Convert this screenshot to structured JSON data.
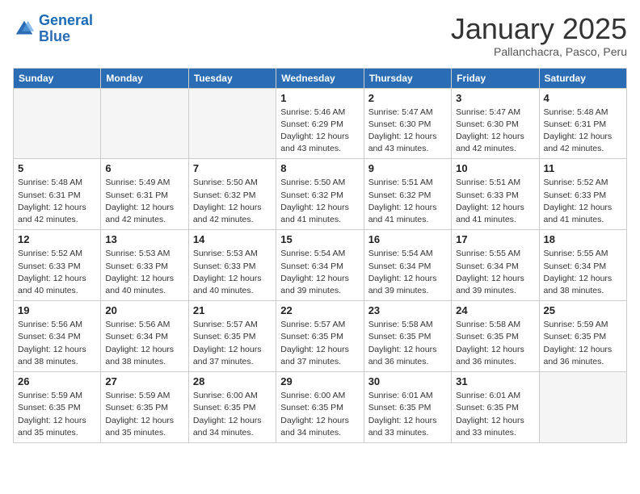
{
  "header": {
    "logo_general": "General",
    "logo_blue": "Blue",
    "month_title": "January 2025",
    "subtitle": "Pallanchacra, Pasco, Peru"
  },
  "weekdays": [
    "Sunday",
    "Monday",
    "Tuesday",
    "Wednesday",
    "Thursday",
    "Friday",
    "Saturday"
  ],
  "weeks": [
    [
      {
        "day": "",
        "sunrise": "",
        "sunset": "",
        "daylight": "",
        "empty": true
      },
      {
        "day": "",
        "sunrise": "",
        "sunset": "",
        "daylight": "",
        "empty": true
      },
      {
        "day": "",
        "sunrise": "",
        "sunset": "",
        "daylight": "",
        "empty": true
      },
      {
        "day": "1",
        "sunrise": "Sunrise: 5:46 AM",
        "sunset": "Sunset: 6:29 PM",
        "daylight": "Daylight: 12 hours and 43 minutes."
      },
      {
        "day": "2",
        "sunrise": "Sunrise: 5:47 AM",
        "sunset": "Sunset: 6:30 PM",
        "daylight": "Daylight: 12 hours and 43 minutes."
      },
      {
        "day": "3",
        "sunrise": "Sunrise: 5:47 AM",
        "sunset": "Sunset: 6:30 PM",
        "daylight": "Daylight: 12 hours and 42 minutes."
      },
      {
        "day": "4",
        "sunrise": "Sunrise: 5:48 AM",
        "sunset": "Sunset: 6:31 PM",
        "daylight": "Daylight: 12 hours and 42 minutes."
      }
    ],
    [
      {
        "day": "5",
        "sunrise": "Sunrise: 5:48 AM",
        "sunset": "Sunset: 6:31 PM",
        "daylight": "Daylight: 12 hours and 42 minutes."
      },
      {
        "day": "6",
        "sunrise": "Sunrise: 5:49 AM",
        "sunset": "Sunset: 6:31 PM",
        "daylight": "Daylight: 12 hours and 42 minutes."
      },
      {
        "day": "7",
        "sunrise": "Sunrise: 5:50 AM",
        "sunset": "Sunset: 6:32 PM",
        "daylight": "Daylight: 12 hours and 42 minutes."
      },
      {
        "day": "8",
        "sunrise": "Sunrise: 5:50 AM",
        "sunset": "Sunset: 6:32 PM",
        "daylight": "Daylight: 12 hours and 41 minutes."
      },
      {
        "day": "9",
        "sunrise": "Sunrise: 5:51 AM",
        "sunset": "Sunset: 6:32 PM",
        "daylight": "Daylight: 12 hours and 41 minutes."
      },
      {
        "day": "10",
        "sunrise": "Sunrise: 5:51 AM",
        "sunset": "Sunset: 6:33 PM",
        "daylight": "Daylight: 12 hours and 41 minutes."
      },
      {
        "day": "11",
        "sunrise": "Sunrise: 5:52 AM",
        "sunset": "Sunset: 6:33 PM",
        "daylight": "Daylight: 12 hours and 41 minutes."
      }
    ],
    [
      {
        "day": "12",
        "sunrise": "Sunrise: 5:52 AM",
        "sunset": "Sunset: 6:33 PM",
        "daylight": "Daylight: 12 hours and 40 minutes."
      },
      {
        "day": "13",
        "sunrise": "Sunrise: 5:53 AM",
        "sunset": "Sunset: 6:33 PM",
        "daylight": "Daylight: 12 hours and 40 minutes."
      },
      {
        "day": "14",
        "sunrise": "Sunrise: 5:53 AM",
        "sunset": "Sunset: 6:33 PM",
        "daylight": "Daylight: 12 hours and 40 minutes."
      },
      {
        "day": "15",
        "sunrise": "Sunrise: 5:54 AM",
        "sunset": "Sunset: 6:34 PM",
        "daylight": "Daylight: 12 hours and 39 minutes."
      },
      {
        "day": "16",
        "sunrise": "Sunrise: 5:54 AM",
        "sunset": "Sunset: 6:34 PM",
        "daylight": "Daylight: 12 hours and 39 minutes."
      },
      {
        "day": "17",
        "sunrise": "Sunrise: 5:55 AM",
        "sunset": "Sunset: 6:34 PM",
        "daylight": "Daylight: 12 hours and 39 minutes."
      },
      {
        "day": "18",
        "sunrise": "Sunrise: 5:55 AM",
        "sunset": "Sunset: 6:34 PM",
        "daylight": "Daylight: 12 hours and 38 minutes."
      }
    ],
    [
      {
        "day": "19",
        "sunrise": "Sunrise: 5:56 AM",
        "sunset": "Sunset: 6:34 PM",
        "daylight": "Daylight: 12 hours and 38 minutes."
      },
      {
        "day": "20",
        "sunrise": "Sunrise: 5:56 AM",
        "sunset": "Sunset: 6:34 PM",
        "daylight": "Daylight: 12 hours and 38 minutes."
      },
      {
        "day": "21",
        "sunrise": "Sunrise: 5:57 AM",
        "sunset": "Sunset: 6:35 PM",
        "daylight": "Daylight: 12 hours and 37 minutes."
      },
      {
        "day": "22",
        "sunrise": "Sunrise: 5:57 AM",
        "sunset": "Sunset: 6:35 PM",
        "daylight": "Daylight: 12 hours and 37 minutes."
      },
      {
        "day": "23",
        "sunrise": "Sunrise: 5:58 AM",
        "sunset": "Sunset: 6:35 PM",
        "daylight": "Daylight: 12 hours and 36 minutes."
      },
      {
        "day": "24",
        "sunrise": "Sunrise: 5:58 AM",
        "sunset": "Sunset: 6:35 PM",
        "daylight": "Daylight: 12 hours and 36 minutes."
      },
      {
        "day": "25",
        "sunrise": "Sunrise: 5:59 AM",
        "sunset": "Sunset: 6:35 PM",
        "daylight": "Daylight: 12 hours and 36 minutes."
      }
    ],
    [
      {
        "day": "26",
        "sunrise": "Sunrise: 5:59 AM",
        "sunset": "Sunset: 6:35 PM",
        "daylight": "Daylight: 12 hours and 35 minutes."
      },
      {
        "day": "27",
        "sunrise": "Sunrise: 5:59 AM",
        "sunset": "Sunset: 6:35 PM",
        "daylight": "Daylight: 12 hours and 35 minutes."
      },
      {
        "day": "28",
        "sunrise": "Sunrise: 6:00 AM",
        "sunset": "Sunset: 6:35 PM",
        "daylight": "Daylight: 12 hours and 34 minutes."
      },
      {
        "day": "29",
        "sunrise": "Sunrise: 6:00 AM",
        "sunset": "Sunset: 6:35 PM",
        "daylight": "Daylight: 12 hours and 34 minutes."
      },
      {
        "day": "30",
        "sunrise": "Sunrise: 6:01 AM",
        "sunset": "Sunset: 6:35 PM",
        "daylight": "Daylight: 12 hours and 33 minutes."
      },
      {
        "day": "31",
        "sunrise": "Sunrise: 6:01 AM",
        "sunset": "Sunset: 6:35 PM",
        "daylight": "Daylight: 12 hours and 33 minutes."
      },
      {
        "day": "",
        "sunrise": "",
        "sunset": "",
        "daylight": "",
        "empty": true
      }
    ]
  ]
}
